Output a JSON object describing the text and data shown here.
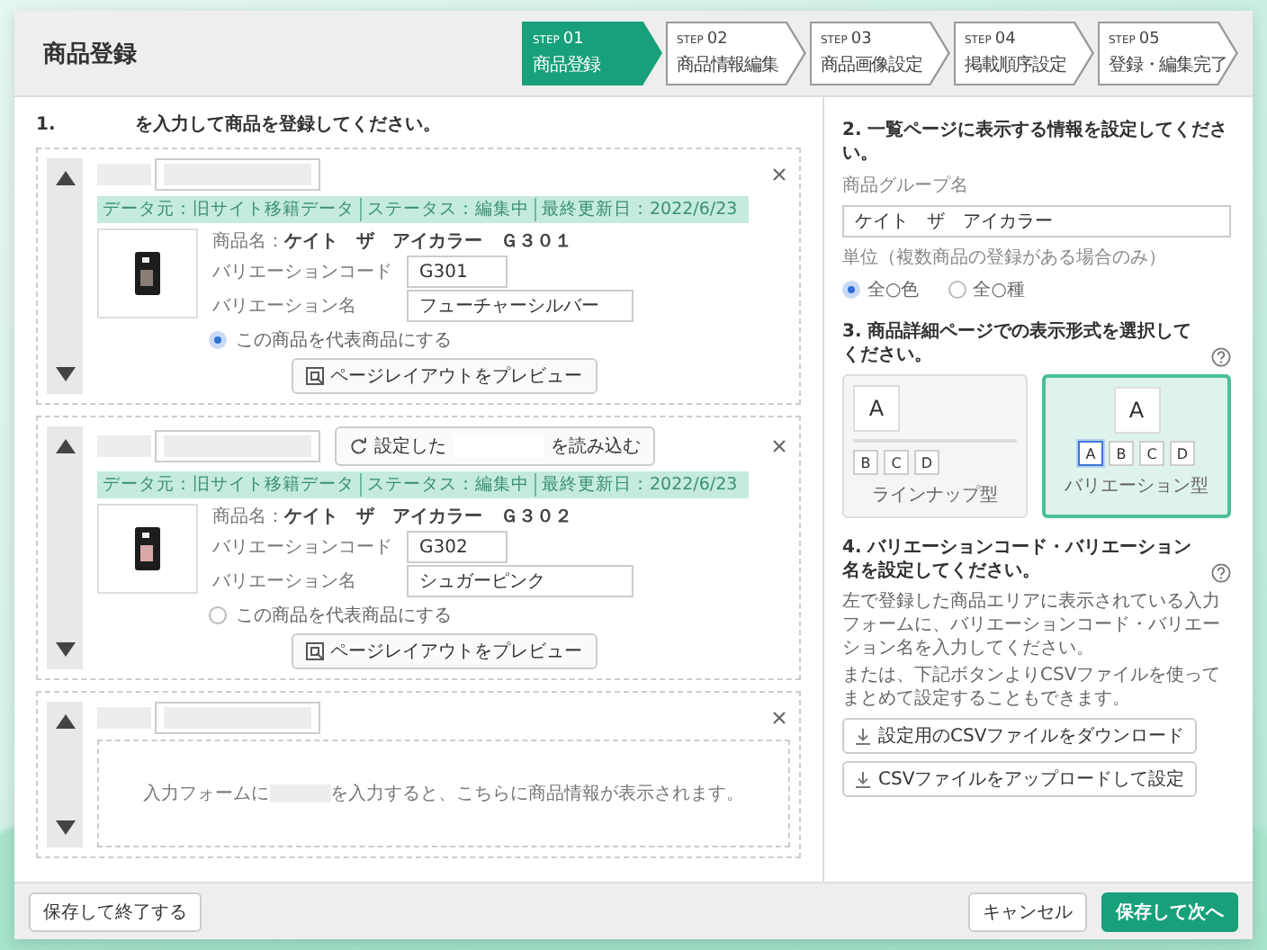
{
  "window": {
    "title": "商品登録"
  },
  "steps": [
    {
      "label": "STEP",
      "number": "01",
      "title": "商品登録",
      "selected": true
    },
    {
      "label": "STEP",
      "number": "02",
      "title": "商品情報編集",
      "selected": false
    },
    {
      "label": "STEP",
      "number": "03",
      "title": "商品画像設定",
      "selected": false
    },
    {
      "label": "STEP",
      "number": "04",
      "title": "掲載順序設定",
      "selected": false
    },
    {
      "label": "STEP",
      "number": "05",
      "title": "登録・編集完了",
      "selected": false
    }
  ],
  "section_1": {
    "number": "1.",
    "heading": "を入力して商品を登録してください。"
  },
  "product_cards": [
    {
      "kind": "product",
      "info": [
        "データ元：旧サイト移籍データ",
        "ステータス：編集中",
        "最終更新日：2022/6/23"
      ],
      "product_name_label": "商品名：",
      "product_name": "ケイト　ザ　アイカラー　Ｇ３０１",
      "code_label": "バリエーションコード",
      "code": "G301",
      "name_label": "バリエーション名",
      "name": "フューチャーシルバー",
      "representative": {
        "label": "この商品を代表商品にする",
        "selected": true
      },
      "preview_button": "ページレイアウトをプレビュー"
    },
    {
      "kind": "product",
      "load_button": {
        "prefix": "設定した",
        "suffix": "を読み込む"
      },
      "info": [
        "データ元：旧サイト移籍データ",
        "ステータス：編集中",
        "最終更新日：2022/6/23"
      ],
      "product_name_label": "商品名：",
      "product_name": "ケイト　ザ　アイカラー　Ｇ３０２",
      "code_label": "バリエーションコード",
      "code": "G302",
      "name_label": "バリエーション名",
      "name": "シュガーピンク",
      "representative": {
        "label": "この商品を代表商品にする",
        "selected": false
      },
      "preview_button": "ページレイアウトをプレビュー"
    },
    {
      "kind": "empty",
      "message_prefix": "入力フォームに",
      "message_suffix": "を入力すると、こちらに商品情報が表示されます。"
    }
  ],
  "section_2": {
    "heading": "2. 一覧ページに表示する情報を設定してください。",
    "group_name_label": "商品グループ名",
    "group_name": "ケイト　ザ　アイカラー",
    "unit_label": "単位（複数商品の登録がある場合のみ）",
    "unit_options": [
      {
        "label": "全○色",
        "selected": true
      },
      {
        "label": "全○種",
        "selected": false
      }
    ]
  },
  "section_3": {
    "heading": "3. 商品詳細ページでの表示形式を選択してください。",
    "layouts": [
      {
        "kind": "lineup",
        "label": "ラインナップ型",
        "selected": false,
        "main_letter": "A",
        "thumbs": [
          {
            "letter": "B",
            "selected": false
          },
          {
            "letter": "C",
            "selected": false
          },
          {
            "letter": "D",
            "selected": false
          }
        ]
      },
      {
        "kind": "variation",
        "label": "バリエーション型",
        "selected": true,
        "main_letter": "A",
        "thumbs": [
          {
            "letter": "A",
            "selected": true
          },
          {
            "letter": "B",
            "selected": false
          },
          {
            "letter": "C",
            "selected": false
          },
          {
            "letter": "D",
            "selected": false
          }
        ]
      }
    ]
  },
  "section_4": {
    "heading": "4. バリエーションコード・バリエーション名を設定してください。",
    "description": [
      "左で登録した商品エリアに表示されている入力フォームに、バリエーションコード・バリエーション名を入力してください。",
      "または、下記ボタンよりCSVファイルを使ってまとめて設定することもできます。"
    ],
    "buttons": [
      "設定用のCSVファイルをダウンロード",
      "CSVファイルをアップロードして設定"
    ]
  },
  "footer": {
    "save_exit": "保存して終了する",
    "cancel": "キャンセル",
    "next": "保存して次へ"
  }
}
